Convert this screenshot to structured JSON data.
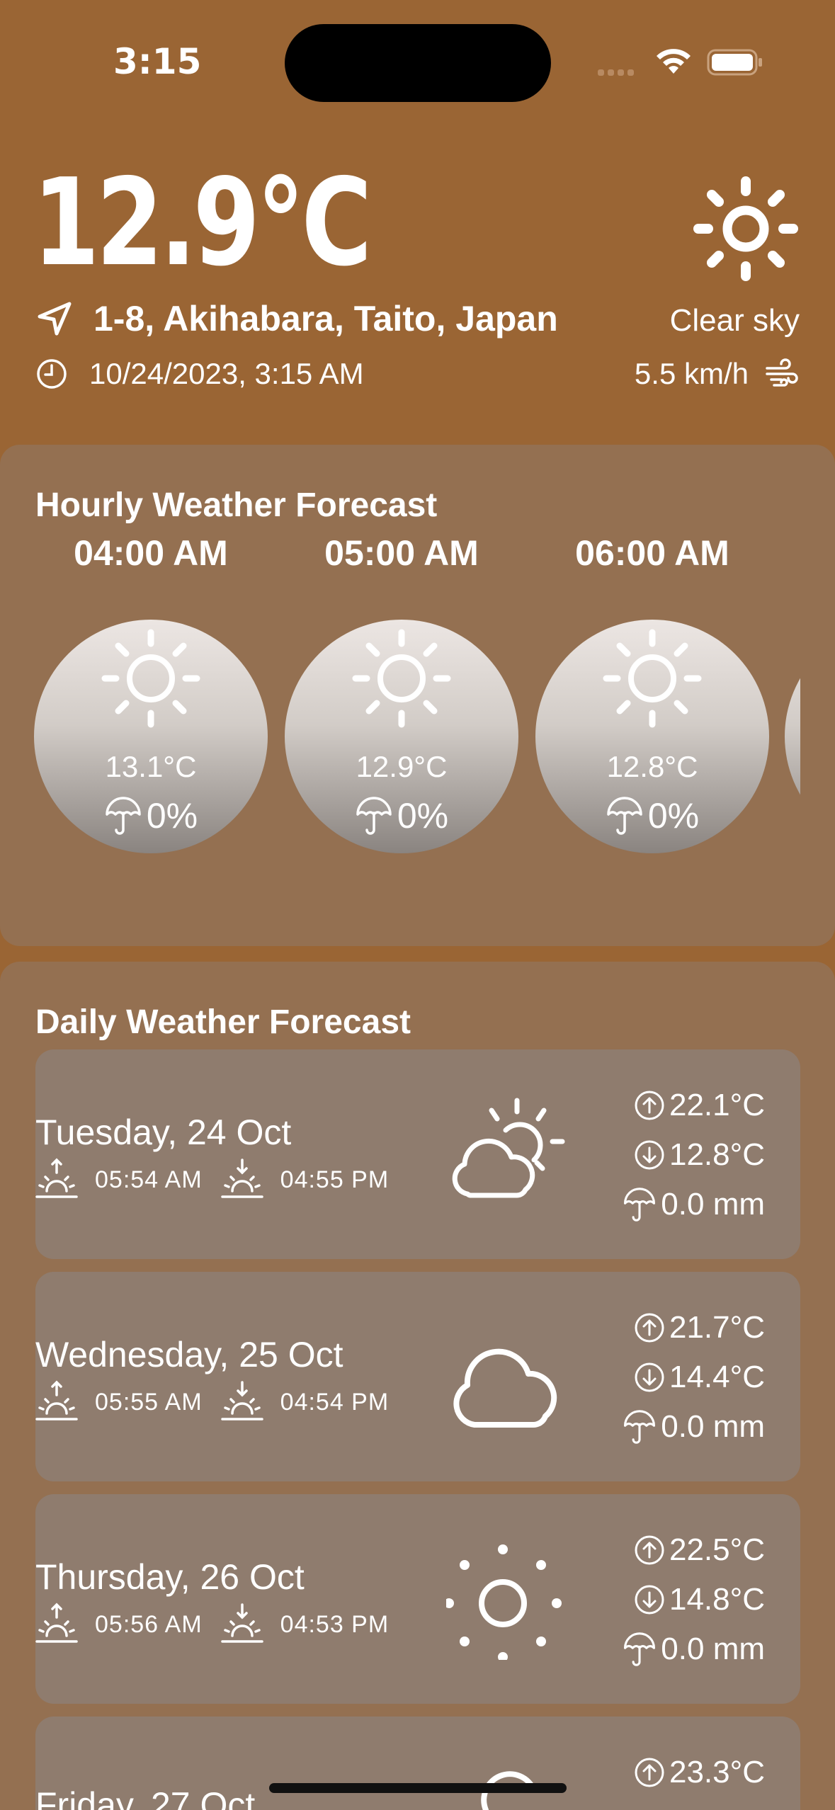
{
  "status_bar": {
    "time": "3:15"
  },
  "current": {
    "temperature": "12.9°C",
    "location": "1-8, Akihabara, Taito, Japan",
    "datetime": "10/24/2023, 3:15 AM",
    "condition": "Clear sky",
    "wind": "5.5 km/h",
    "icon": "sun-icon"
  },
  "hourly": {
    "title": "Hourly Weather Forecast",
    "items": [
      {
        "time": "04:00 AM",
        "temp": "13.1°C",
        "rain": "0%",
        "icon": "sun-icon"
      },
      {
        "time": "05:00 AM",
        "temp": "12.9°C",
        "rain": "0%",
        "icon": "sun-icon"
      },
      {
        "time": "06:00 AM",
        "temp": "12.8°C",
        "rain": "0%",
        "icon": "sun-icon"
      }
    ]
  },
  "daily": {
    "title": "Daily Weather Forecast",
    "items": [
      {
        "day": "Tuesday, 24 Oct",
        "sunrise": "05:54 AM",
        "sunset": "04:55 PM",
        "high": "22.1°C",
        "low": "12.8°C",
        "precip": "0.0 mm",
        "icon": "partly-cloudy-icon"
      },
      {
        "day": "Wednesday, 25 Oct",
        "sunrise": "05:55 AM",
        "sunset": "04:54 PM",
        "high": "21.7°C",
        "low": "14.4°C",
        "precip": "0.0 mm",
        "icon": "cloud-icon"
      },
      {
        "day": "Thursday, 26 Oct",
        "sunrise": "05:56 AM",
        "sunset": "04:53 PM",
        "high": "22.5°C",
        "low": "14.8°C",
        "precip": "0.0 mm",
        "icon": "sun-dotted-icon"
      },
      {
        "day": "Friday, 27 Oct",
        "high": "23.3°C"
      }
    ]
  },
  "colors": {
    "background": "#9a6534",
    "card": "#947051",
    "row": "#8f7c6e"
  }
}
